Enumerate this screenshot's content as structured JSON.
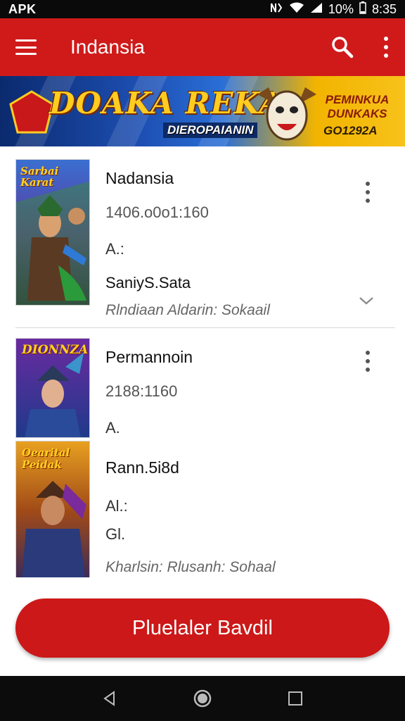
{
  "status_bar": {
    "left_text": "APK",
    "battery": "10%",
    "time": "8:35",
    "icons": [
      "nfc-icon",
      "wifi-icon",
      "signal-icon",
      "battery-icon"
    ]
  },
  "app_bar": {
    "title": "Indansia",
    "icons": [
      "menu-icon",
      "search-icon",
      "more-vert-icon"
    ]
  },
  "banner": {
    "title": "DOAKA REKA",
    "subtitle": "DIEROPAIANIN",
    "right_text": "PEMINKUA DUNKAKS",
    "code": "GO1292A"
  },
  "list": {
    "items": [
      {
        "title": "Nadansia",
        "meta": "1406.o0o1:160",
        "field": "A.:",
        "subtitle": "SaniyS.Sata",
        "description": "Rlndiaan Aldarin: Sokaail",
        "thumb_text": "Sarbai Karat"
      },
      {
        "title": "Permannoin",
        "meta": "2188:1160",
        "field": "A.",
        "subtitle": "Rann.5i8d",
        "field2": "Al.:",
        "field3": "Gl.",
        "description": "Kharlsin: Rlusanh: Sohaal",
        "thumb_text_a": "DIONNZA",
        "thumb_text_b": "Oearital Peidak"
      }
    ]
  },
  "cta": {
    "label": "Pluelaler Bavdil"
  },
  "colors": {
    "brand_red": "#d01a1a",
    "status_black": "#0a0a0a"
  }
}
